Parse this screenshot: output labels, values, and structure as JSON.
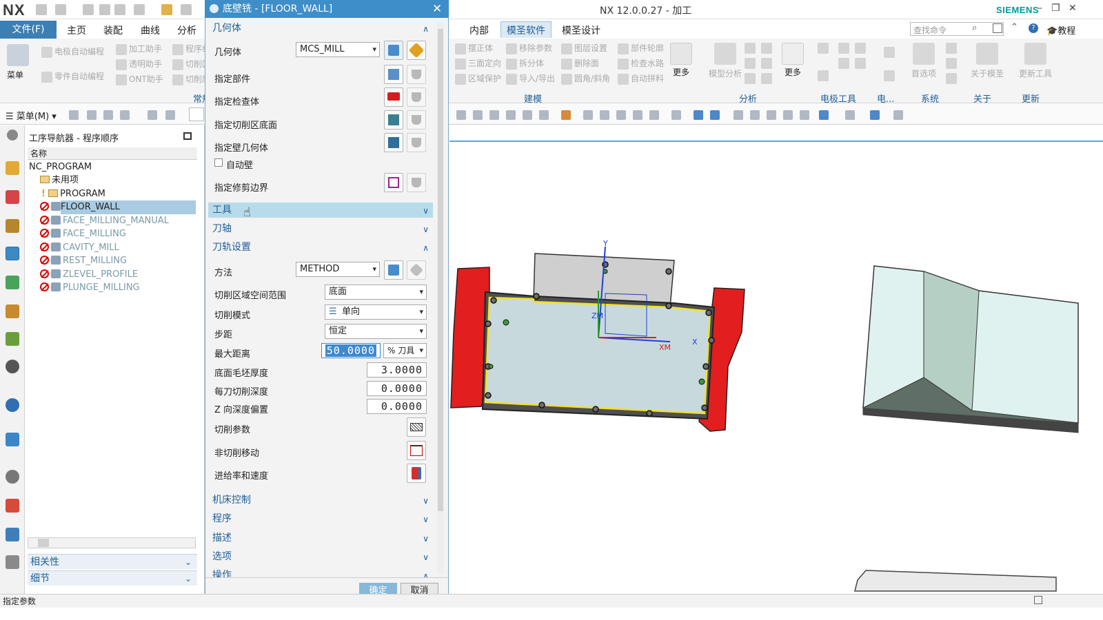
{
  "titlebar": {
    "logo": "NX",
    "app_title": "NX 12.0.0.27 - 加工",
    "brand": "SIEMENS"
  },
  "ribbon_tabs": {
    "file": "文件(F)",
    "tabs": [
      "主页",
      "装配",
      "曲线",
      "分析",
      "内部",
      "模圣软件",
      "模圣设计"
    ],
    "search_placeholder": "查找命令",
    "tutorial": "教程"
  },
  "ribbon": {
    "menu_label": "菜单",
    "left_items": [
      "电极自动编程",
      "加工助手",
      "程序组",
      "零件自动编程",
      "透明助手",
      "切削区",
      "ONT助手",
      "切削层"
    ],
    "left_group": "常规",
    "build_items": [
      "摆正体",
      "移除参数",
      "图层设置",
      "部件轮廓",
      "三面定向",
      "拆分体",
      "删除面",
      "检查水路",
      "区域保护",
      "导入/导出",
      "圆角/斜角",
      "自动拼料"
    ],
    "more1": "更多",
    "more2": "更多",
    "model_analysis": "模型分析",
    "preferences": "首选项",
    "about_mold": "关于模圣",
    "update_tool": "更新工具",
    "groups": [
      "建模",
      "分析",
      "电极工具",
      "电...",
      "系统",
      "关于",
      "更新"
    ]
  },
  "toolbar": {
    "menu_button": "菜单(M)"
  },
  "navigator": {
    "title": "工序导航器 - 程序顺序",
    "column_name": "名称",
    "rows": [
      {
        "label": "NC_PROGRAM"
      },
      {
        "label": "未用项"
      },
      {
        "label": "PROGRAM"
      },
      {
        "label": "FLOOR_WALL"
      },
      {
        "label": "FACE_MILLING_MANUAL"
      },
      {
        "label": "FACE_MILLING"
      },
      {
        "label": "CAVITY_MILL"
      },
      {
        "label": "REST_MILLING"
      },
      {
        "label": "ZLEVEL_PROFILE"
      },
      {
        "label": "PLUNGE_MILLING"
      }
    ],
    "footer": [
      "相关性",
      "细节"
    ]
  },
  "dialog": {
    "title": "底壁铣 - [FLOOR_WALL]",
    "sections": {
      "geometry": "几何体",
      "tool": "工具",
      "axis": "刀轴",
      "path_settings": "刀轨设置",
      "machine_control": "机床控制",
      "program": "程序",
      "description": "描述",
      "options": "选项",
      "operation": "操作"
    },
    "geometry": {
      "geometry_label": "几何体",
      "geometry_value": "MCS_MILL",
      "specify_part": "指定部件",
      "specify_check": "指定检查体",
      "specify_floor": "指定切削区底面",
      "specify_wall": "指定壁几何体",
      "auto_wall": "自动壁",
      "specify_trim": "指定修剪边界"
    },
    "path": {
      "method_label": "方法",
      "method_value": "METHOD",
      "cut_region_label": "切削区域空间范围",
      "cut_region_value": "底面",
      "cut_pattern_label": "切削模式",
      "cut_pattern_value": "单向",
      "stepover_label": "步距",
      "stepover_value": "恒定",
      "max_distance_label": "最大距离",
      "max_distance_value": "50.0000",
      "max_distance_unit": "% 刀具",
      "floor_stock_label": "底面毛坯厚度",
      "floor_stock_value": "3.0000",
      "depth_per_cut_label": "每刀切削深度",
      "depth_per_cut_value": "0.0000",
      "z_offset_label": "Z 向深度偏置",
      "z_offset_value": "0.0000",
      "cut_params": "切削参数",
      "non_cut_moves": "非切削移动",
      "feeds_speeds": "进给率和速度"
    },
    "ok": "确定",
    "cancel": "取消"
  },
  "viewport": {
    "axis_y": "Y",
    "axis_zm": "ZM",
    "axis_xm": "XM",
    "axis_x": "X"
  },
  "statusbar": {
    "text": "指定参数"
  }
}
